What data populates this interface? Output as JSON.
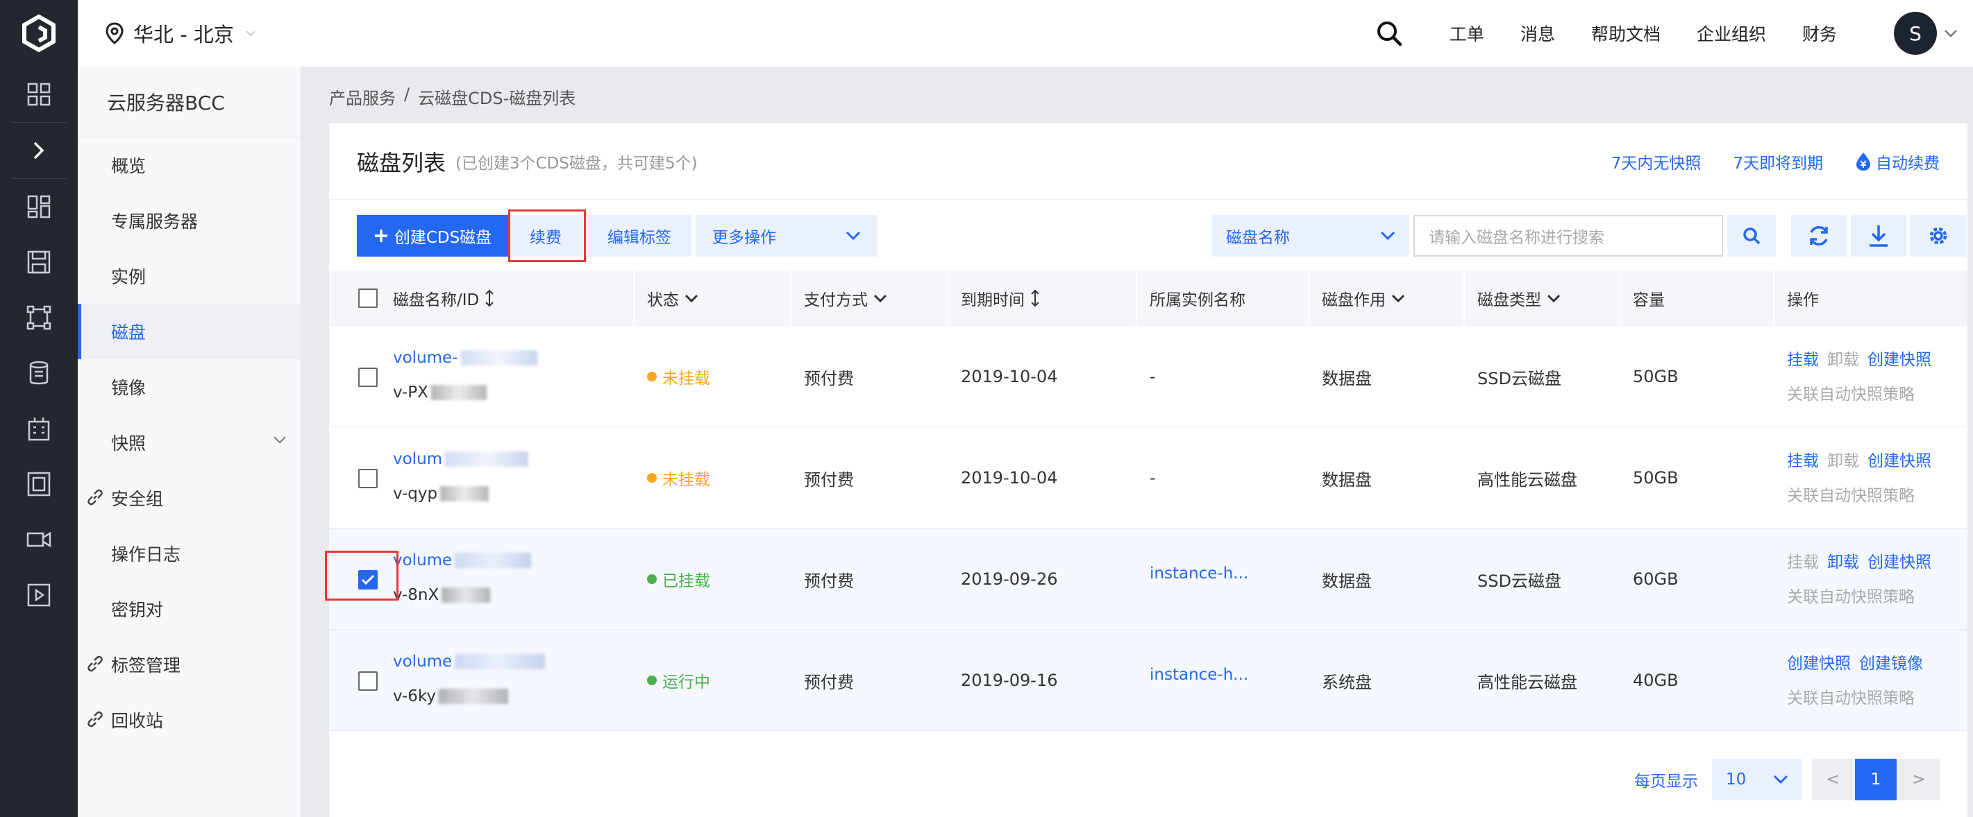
{
  "topbar": {
    "region": "华北 - 北京",
    "nav": [
      "工单",
      "消息",
      "帮助文档",
      "企业组织",
      "财务"
    ],
    "avatar_letter": "S"
  },
  "sidebar": {
    "product": "云服务器BCC",
    "items": [
      {
        "label": "概览"
      },
      {
        "label": "专属服务器"
      },
      {
        "label": "实例"
      },
      {
        "label": "磁盘"
      },
      {
        "label": "镜像"
      },
      {
        "label": "快照"
      },
      {
        "label": "安全组"
      },
      {
        "label": "操作日志"
      },
      {
        "label": "密钥对"
      },
      {
        "label": "标签管理"
      },
      {
        "label": "回收站"
      }
    ]
  },
  "breadcrumb": {
    "root": "产品服务",
    "sep": "/",
    "current": "云磁盘CDS-磁盘列表"
  },
  "card": {
    "title": "磁盘列表",
    "subtitle": "(已创建3个CDS磁盘，共可建5个)",
    "links": {
      "no_snapshot": "7天内无快照",
      "expiring": "7天即将到期",
      "auto_renew": "自动续费"
    }
  },
  "toolbar": {
    "create": "创建CDS磁盘",
    "renew": "续费",
    "edit_tags": "编辑标签",
    "more_ops": "更多操作",
    "search_field": "磁盘名称",
    "search_placeholder": "请输入磁盘名称进行搜索"
  },
  "table": {
    "headers": {
      "name": "磁盘名称/ID",
      "status": "状态",
      "pay": "支付方式",
      "expire": "到期时间",
      "instance": "所属实例名称",
      "role": "磁盘作用",
      "type": "磁盘类型",
      "capacity": "容量",
      "ops": "操作"
    },
    "rows": [
      {
        "name": "volume-",
        "id": "v-PX",
        "status": "未挂载",
        "pay": "预付费",
        "expire": "2019-10-04",
        "instance": "-",
        "role": "数据盘",
        "type": "SSD云磁盘",
        "capacity": "50GB",
        "op1": "挂载",
        "op2": "卸载",
        "op3": "创建快照",
        "op_sub": "关联自动快照策略"
      },
      {
        "name": "volum",
        "id": "v-qyp",
        "status": "未挂载",
        "pay": "预付费",
        "expire": "2019-10-04",
        "instance": "-",
        "role": "数据盘",
        "type": "高性能云磁盘",
        "capacity": "50GB",
        "op1": "挂载",
        "op2": "卸载",
        "op3": "创建快照",
        "op_sub": "关联自动快照策略"
      },
      {
        "name": "volume",
        "id": "v-8nX",
        "status": "已挂载",
        "pay": "预付费",
        "expire": "2019-09-26",
        "instance": "instance-h...",
        "role": "数据盘",
        "type": "SSD云磁盘",
        "capacity": "60GB",
        "op1": "挂载",
        "op2": "卸载",
        "op3": "创建快照",
        "op_sub": "关联自动快照策略"
      },
      {
        "name": "volume",
        "id": "v-6ky",
        "status": "运行中",
        "pay": "预付费",
        "expire": "2019-09-16",
        "instance": "instance-h...",
        "role": "系统盘",
        "type": "高性能云磁盘",
        "capacity": "40GB",
        "op1": "创建快照",
        "op2": "创建镜像",
        "op_sub": "关联自动快照策略"
      }
    ]
  },
  "pager": {
    "label": "每页显示",
    "size": "10",
    "prev": "<",
    "current": "1",
    "next": ">"
  },
  "colors": {
    "accent": "#2468f2",
    "warn": "#f5a623",
    "ok": "#4caf50",
    "rail": "#23272e",
    "highlight_box": "#e53935"
  }
}
